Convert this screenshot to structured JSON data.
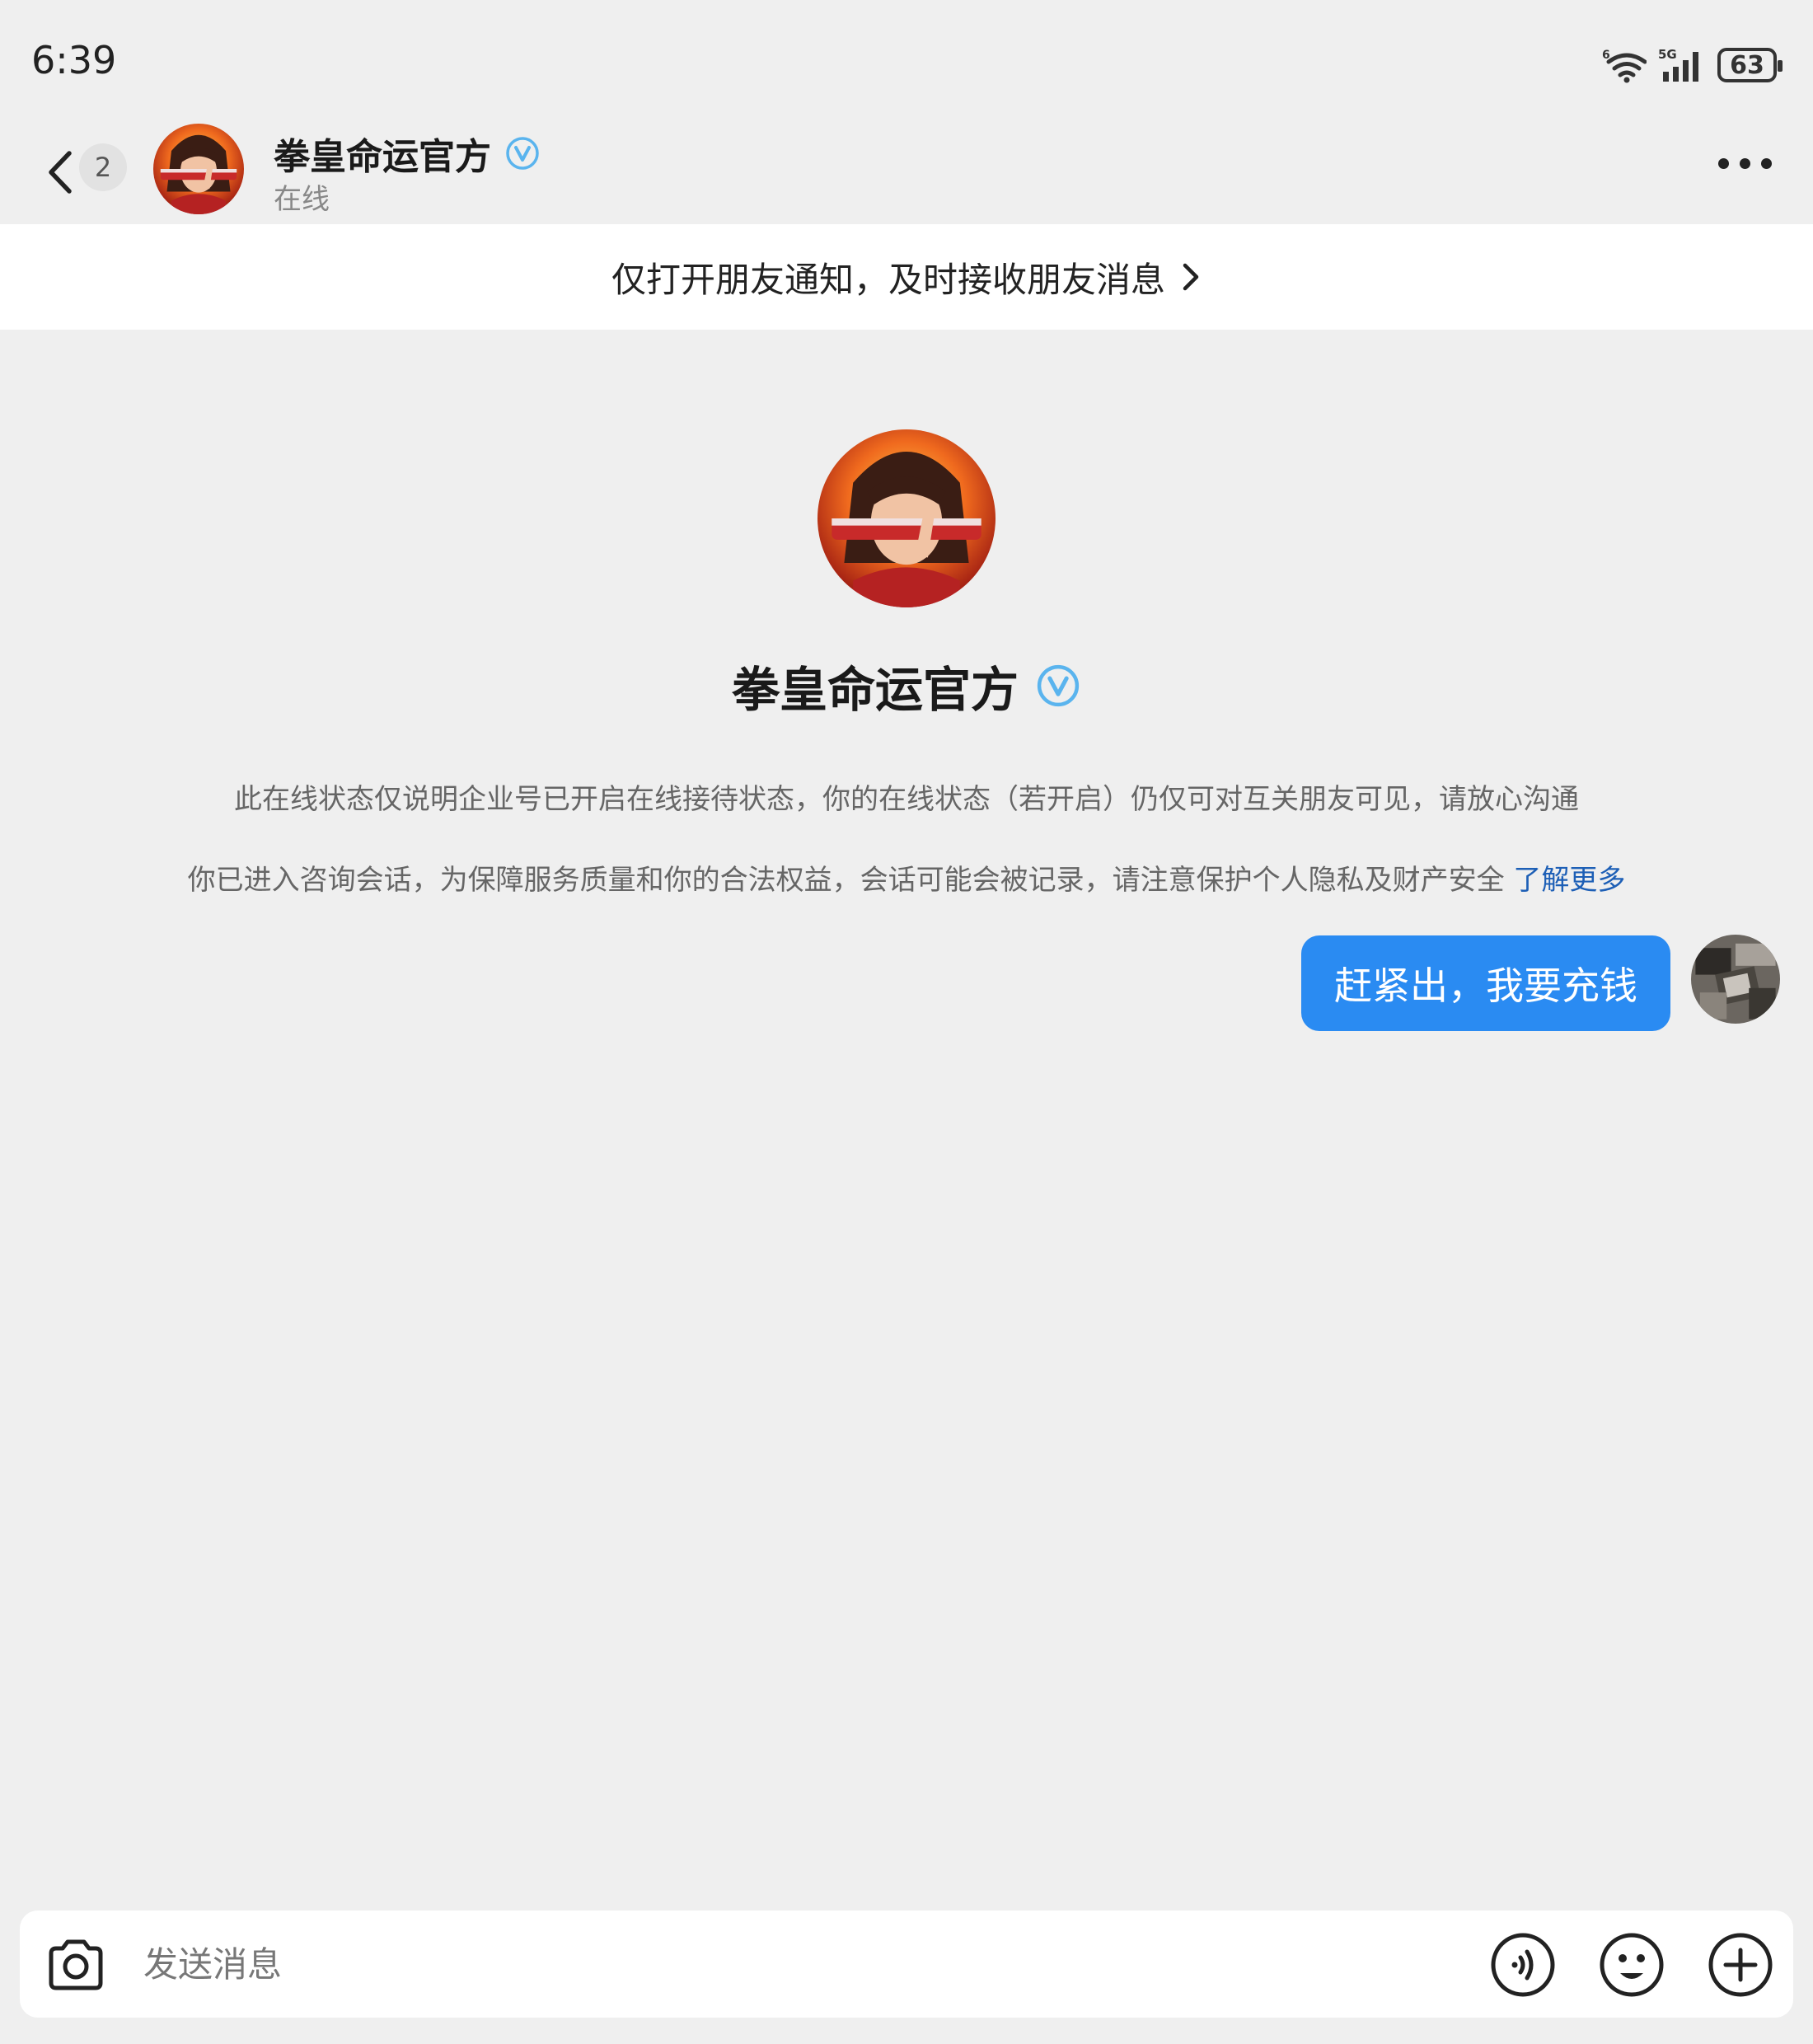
{
  "status_bar": {
    "time": "6:39",
    "network": "5G",
    "wifi_badge": "6",
    "battery": "63"
  },
  "header": {
    "unread_count": "2",
    "name": "拳皇命运官方",
    "status": "在线"
  },
  "notice": {
    "text": "仅打开朋友通知，及时接收朋友消息"
  },
  "profile": {
    "name": "拳皇命运官方"
  },
  "info": {
    "line1": "此在线状态仅说明企业号已开启在线接待状态，你的在线状态（若开启）仍仅可对互关朋友可见，请放心沟通",
    "line2": "你已进入咨询会话，为保障服务质量和你的合法权益，会话可能会被记录，请注意保护个人隐私及财产安全",
    "learn_more": "了解更多"
  },
  "messages": [
    {
      "text": "赶紧出，我要充钱"
    }
  ],
  "input": {
    "placeholder": "发送消息"
  },
  "colors": {
    "accent": "#2a8bf2",
    "verified": "#5ab4ee",
    "link": "#1d5fb6",
    "background": "#efefef"
  },
  "icons": [
    "back-icon",
    "verified-icon",
    "chevron-right-icon",
    "more-icon",
    "camera-icon",
    "voice-icon",
    "emoji-icon",
    "plus-icon",
    "wifi-icon",
    "signal-icon",
    "battery-icon"
  ]
}
